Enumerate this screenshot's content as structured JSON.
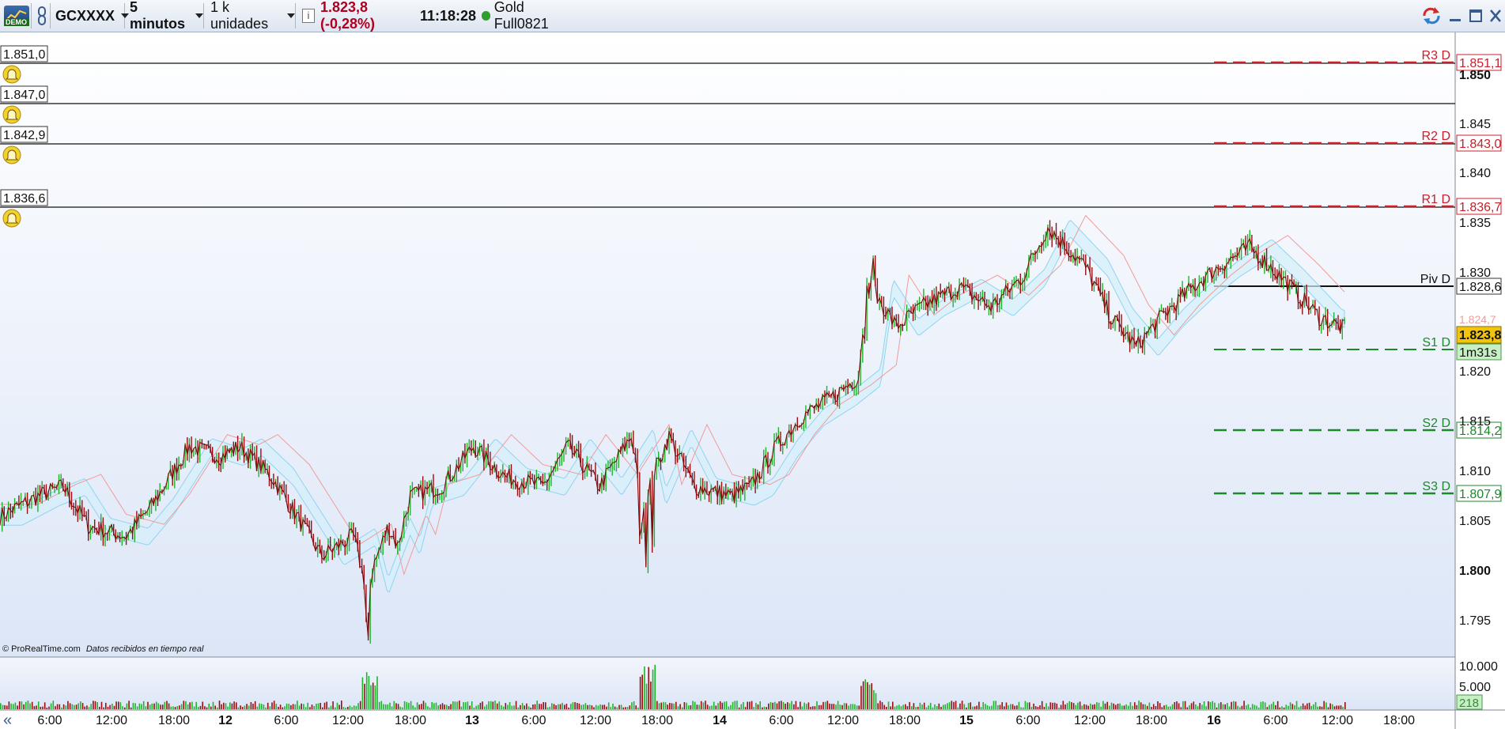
{
  "toolbar": {
    "demo_badge": "DEMO",
    "symbol": "GCXXXX",
    "timeframe": "5 minutos",
    "units": "1 k unidades",
    "info_icon": "i",
    "price_change": "1.823,8 (-0,28%)",
    "time": "11:18:28",
    "instrument": "Gold Full0821",
    "colors": {
      "down": "#b00020",
      "live_dot": "#2e9e2e"
    }
  },
  "alerts": [
    {
      "value": "1.851,0"
    },
    {
      "value": "1.847,0"
    },
    {
      "value": "1.842,9"
    },
    {
      "value": "1.836,6"
    }
  ],
  "pivots": [
    {
      "label": "R3 D",
      "value": "1.851,1",
      "color": "#c8202a"
    },
    {
      "label": "R2 D",
      "value": "1.843,0",
      "color": "#c8202a"
    },
    {
      "label": "R1 D",
      "value": "1.836,7",
      "color": "#c8202a"
    },
    {
      "label": "Piv D",
      "value": "1.828,6",
      "color": "#111111"
    },
    {
      "label": "S1 D",
      "value": "",
      "color": "#1a8a2a"
    },
    {
      "label": "S2 D",
      "value": "1.814,2",
      "color": "#1a8a2a"
    },
    {
      "label": "S3 D",
      "value": "1.807,9",
      "color": "#1a8a2a"
    }
  ],
  "price_axis": [
    "1.850",
    "1.845",
    "1.840",
    "1.835",
    "1.830",
    "1.820",
    "1.815",
    "1.810",
    "1.805",
    "1.800",
    "1.795"
  ],
  "current_price": "1.823,8",
  "hidden_price": "1.824,7",
  "countdown": "1m31s",
  "volume_axis": [
    "10.000",
    "5.000"
  ],
  "volume_value": "218",
  "time_axis": [
    "6:00",
    "12:00",
    "18:00",
    "12",
    "6:00",
    "12:00",
    "18:00",
    "13",
    "6:00",
    "12:00",
    "18:00",
    "14",
    "6:00",
    "12:00",
    "18:00",
    "15",
    "6:00",
    "12:00",
    "18:00",
    "16",
    "6:00",
    "12:00",
    "18:00"
  ],
  "watermark": {
    "brand": "© ProRealTime.com",
    "status": "Datos recibidos en tiempo real"
  },
  "nav_icon": "«",
  "colors": {
    "up_candle": "#1fb52a",
    "down_candle": "#9b0d10",
    "bg_top": "#ffffff",
    "bg_bottom": "#dce6f7",
    "cloud": "#d4f0fb",
    "cloud_red": "#f6d3d3"
  },
  "chart_data": {
    "type": "candlestick",
    "instrument": "Gold Full0821",
    "timeframe": "5 minutos",
    "ylim": [
      1792,
      1853
    ],
    "x_labels": [
      "6:00",
      "12:00",
      "18:00",
      "12",
      "6:00",
      "12:00",
      "18:00",
      "13",
      "6:00",
      "12:00",
      "18:00",
      "14",
      "6:00",
      "12:00",
      "18:00",
      "15",
      "6:00",
      "12:00",
      "18:00",
      "16",
      "6:00",
      "12:00",
      "18:00"
    ],
    "price_path": [
      [
        0,
        1805
      ],
      [
        0.6,
        1807
      ],
      [
        1.0,
        1808
      ],
      [
        1.4,
        1804
      ],
      [
        2.0,
        1803
      ],
      [
        2.4,
        1806
      ],
      [
        3.0,
        1812
      ],
      [
        3.5,
        1811
      ],
      [
        3.8,
        1812
      ],
      [
        4.3,
        1809
      ],
      [
        4.7,
        1805
      ],
      [
        5.1,
        1801
      ],
      [
        5.6,
        1803
      ],
      [
        5.8,
        1798
      ],
      [
        6.15,
        1804
      ],
      [
        6.3,
        1802
      ],
      [
        6.5,
        1807
      ],
      [
        7.0,
        1808
      ],
      [
        7.5,
        1812
      ],
      [
        8.0,
        1809
      ],
      [
        8.6,
        1808
      ],
      [
        9.0,
        1812
      ],
      [
        9.5,
        1808
      ],
      [
        10.0,
        1813
      ],
      [
        10.2,
        1807
      ],
      [
        10.4,
        1810
      ],
      [
        10.6,
        1813
      ],
      [
        11.0,
        1808
      ],
      [
        11.6,
        1807
      ],
      [
        11.9,
        1808
      ],
      [
        12.3,
        1812
      ],
      [
        12.7,
        1815
      ],
      [
        13.2,
        1817
      ],
      [
        13.6,
        1819
      ],
      [
        13.8,
        1828
      ],
      [
        14.2,
        1824
      ],
      [
        14.6,
        1826
      ],
      [
        15.2,
        1828
      ],
      [
        15.7,
        1826
      ],
      [
        16.2,
        1829
      ],
      [
        16.6,
        1834
      ],
      [
        17.2,
        1830
      ],
      [
        17.6,
        1825
      ],
      [
        18.0,
        1822
      ],
      [
        18.4,
        1825
      ],
      [
        18.9,
        1828
      ],
      [
        19.3,
        1830
      ],
      [
        19.8,
        1832
      ],
      [
        20.3,
        1829
      ],
      [
        20.9,
        1825
      ],
      [
        21.3,
        1823.8
      ]
    ],
    "volume_axis": [
      "10.000",
      "5.000"
    ],
    "volume_value": 218
  }
}
